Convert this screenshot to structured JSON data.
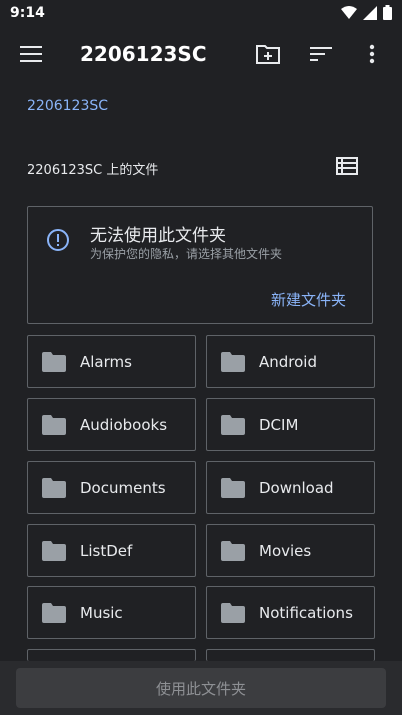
{
  "status_bar": {
    "time": "9:14"
  },
  "app_bar": {
    "title": "2206123SC"
  },
  "breadcrumb": "2206123SC",
  "files_header": "2206123SC 上的文件",
  "warning": {
    "title": "无法使用此文件夹",
    "subtitle": "为保护您的隐私，请选择其他文件夹",
    "new_folder_label": "新建文件夹"
  },
  "folders": [
    "Alarms",
    "Android",
    "Audiobooks",
    "DCIM",
    "Documents",
    "Download",
    "ListDef",
    "Movies",
    "Music",
    "Notifications"
  ],
  "bottom": {
    "use_folder_label": "使用此文件夹"
  },
  "colors": {
    "accent": "#8ab4f8",
    "background": "#202124",
    "border": "#5f6368"
  }
}
